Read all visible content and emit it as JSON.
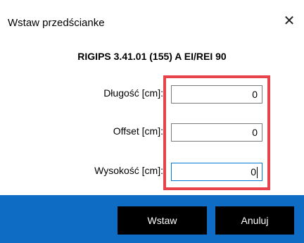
{
  "window": {
    "title": "Wstaw przedścianke",
    "close_glyph": "✕"
  },
  "heading": "RIGIPS 3.41.01 (155) A EI/REI 90",
  "fields": [
    {
      "label": "Długość [cm]:",
      "value": "0"
    },
    {
      "label": "Offset [cm]:",
      "value": "0"
    },
    {
      "label": "Wysokość [cm]:",
      "value": "0"
    }
  ],
  "buttons": {
    "insert": "Wstaw",
    "cancel": "Anuluj"
  },
  "colors": {
    "footer": "#0f6cc4",
    "highlight": "#e8434b",
    "focus": "#0078d7"
  },
  "icons": {
    "close": "close-icon"
  }
}
